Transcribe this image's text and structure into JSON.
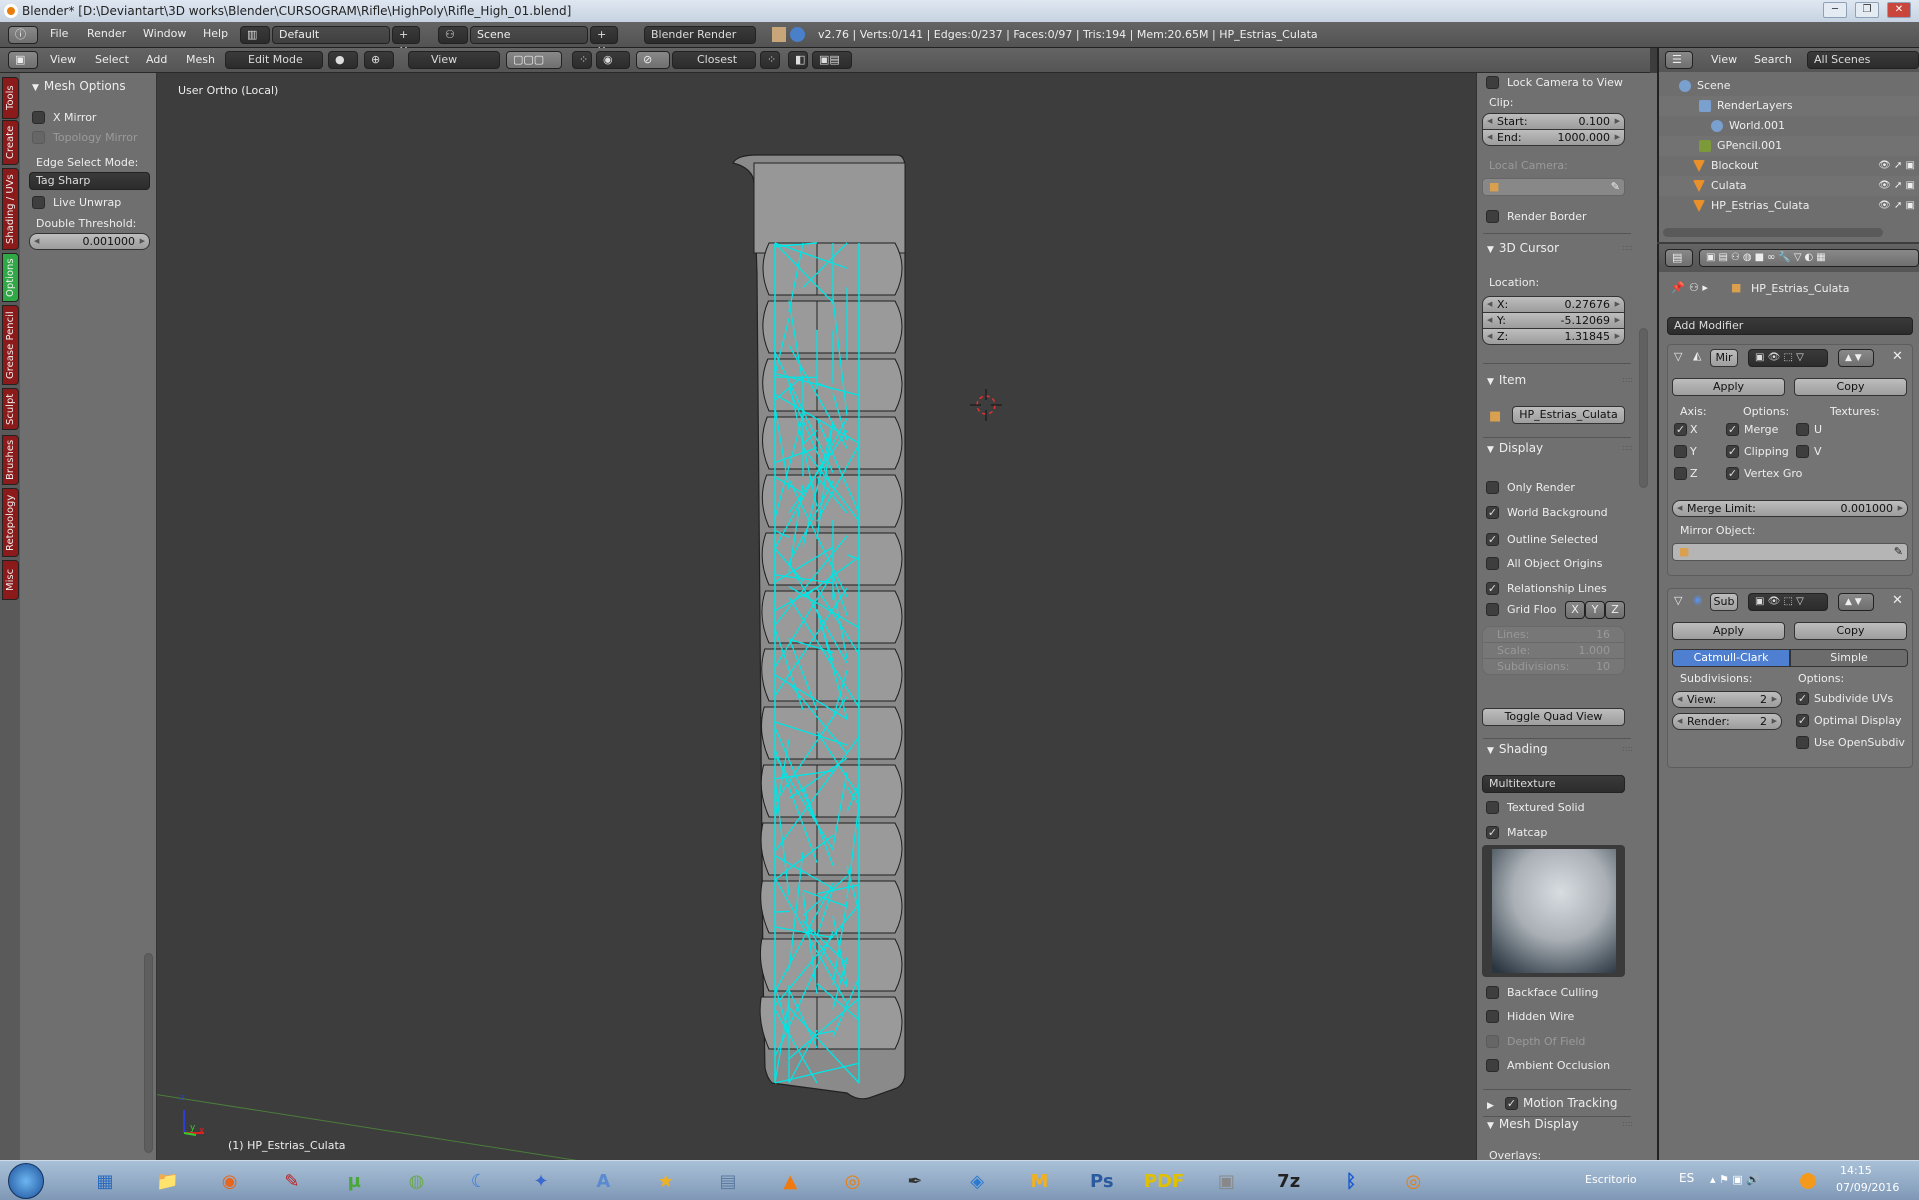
{
  "window": {
    "title": "Blender* [D:\\Deviantart\\3D works\\Blender\\CURSOGRAM\\Rifle\\HighPoly\\Rifle_High_01.blend]",
    "min": "─",
    "max": "❐",
    "close": "✕"
  },
  "info_header": {
    "menus": [
      "File",
      "Render",
      "Window",
      "Help"
    ],
    "layout": "Default",
    "scene": "Scene",
    "engine": "Blender Render",
    "stats": "v2.76 | Verts:0/141 | Edges:0/237 | Faces:0/97 | Tris:194 | Mem:20.65M | HP_Estrias_Culata"
  },
  "view3d_header": {
    "menus": [
      "View",
      "Select",
      "Add",
      "Mesh"
    ],
    "mode": "Edit Mode",
    "orientation": "View",
    "snap_target": "Closest"
  },
  "tool_tabs": [
    {
      "label": "Tools",
      "active": false
    },
    {
      "label": "Create",
      "active": false
    },
    {
      "label": "Shading / UVs",
      "active": false
    },
    {
      "label": "Options",
      "active": true
    },
    {
      "label": "Grease Pencil",
      "active": false
    },
    {
      "label": "Sculpt",
      "active": false
    },
    {
      "label": "Brushes",
      "active": false
    },
    {
      "label": "Retopology",
      "active": false
    },
    {
      "label": "Misc",
      "active": false
    }
  ],
  "tool_shelf": {
    "panel": "Mesh Options",
    "x_mirror": {
      "label": "X Mirror",
      "checked": false
    },
    "topology_mirror": {
      "label": "Topology Mirror",
      "checked": false
    },
    "edge_select_label": "Edge Select Mode:",
    "edge_select_value": "Tag Sharp",
    "live_unwrap": {
      "label": "Live Unwrap",
      "checked": false
    },
    "double_threshold_label": "Double Threshold:",
    "double_threshold": "0.001000"
  },
  "viewport": {
    "view_name": "User Ortho (Local)",
    "object_label": "(1) HP_Estrias_Culata",
    "axis_x": "x",
    "axis_y": "y",
    "axis_z": "z",
    "wire_color": "#00e5e5"
  },
  "n_panel": {
    "lock_camera": "Lock Camera to View",
    "clip_label": "Clip:",
    "clip_start_label": "Start:",
    "clip_start": "0.100",
    "clip_end_label": "End:",
    "clip_end": "1000.000",
    "local_camera_label": "Local Camera:",
    "render_border": {
      "label": "Render Border",
      "checked": false
    },
    "cursor_title": "3D Cursor",
    "location_label": "Location:",
    "x_label": "X:",
    "x": "0.27676",
    "y_label": "Y:",
    "y": "-5.12069",
    "z_label": "Z:",
    "z": "1.31845",
    "item_title": "Item",
    "item_name": "HP_Estrias_Culata",
    "display_title": "Display",
    "display_options": [
      {
        "label": "Only Render",
        "checked": false
      },
      {
        "label": "World Background",
        "checked": true
      },
      {
        "label": "Outline Selected",
        "checked": true
      },
      {
        "label": "All Object Origins",
        "checked": false
      },
      {
        "label": "Relationship Lines",
        "checked": true
      }
    ],
    "grid_floor": {
      "label": "Grid Floo",
      "checked": false
    },
    "grid_axes": [
      "X",
      "Y",
      "Z"
    ],
    "lines_label": "Lines:",
    "lines": "16",
    "scale_label": "Scale:",
    "scale": "1.000",
    "subdiv_label": "Subdivisions:",
    "subdiv": "10",
    "toggle_quad": "Toggle Quad View",
    "shading_title": "Shading",
    "shading_mode": "Multitexture",
    "textured_solid": {
      "label": "Textured Solid",
      "checked": false
    },
    "matcap": {
      "label": "Matcap",
      "checked": true
    },
    "shading_options": [
      {
        "label": "Backface Culling",
        "checked": false
      },
      {
        "label": "Hidden Wire",
        "checked": false
      },
      {
        "label": "Depth Of Field",
        "checked": false
      },
      {
        "label": "Ambient Occlusion",
        "checked": false
      }
    ],
    "motion_tracking": {
      "label": "Motion Tracking",
      "checked": true
    },
    "mesh_display_title": "Mesh Display",
    "overlays_label": "Overlays:"
  },
  "outliner": {
    "menus": [
      "View",
      "Search"
    ],
    "filter": "All Scenes",
    "items": [
      {
        "label": "Scene",
        "icon": "scene-icon"
      },
      {
        "label": "RenderLayers",
        "icon": "render-layers-icon"
      },
      {
        "label": "World.001",
        "icon": "world-icon"
      },
      {
        "label": "GPencil.001",
        "icon": "pencil-icon"
      },
      {
        "label": "Blockout",
        "icon": "mesh-icon"
      },
      {
        "label": "Culata",
        "icon": "mesh-icon"
      },
      {
        "label": "HP_Estrias_Culata",
        "icon": "mesh-icon"
      }
    ]
  },
  "properties": {
    "object": "HP_Estrias_Culata",
    "add_modifier": "Add Modifier",
    "mirror": {
      "name": "Mir",
      "apply": "Apply",
      "copy": "Copy",
      "axis_label": "Axis:",
      "options_label": "Options:",
      "textures_label": "Textures:",
      "axes": [
        {
          "label": "X",
          "checked": true
        },
        {
          "label": "Y",
          "checked": false
        },
        {
          "label": "Z",
          "checked": false
        }
      ],
      "options": [
        {
          "label": "Merge",
          "checked": true
        },
        {
          "label": "Clipping",
          "checked": true
        },
        {
          "label": "Vertex Gro",
          "checked": true
        }
      ],
      "textures": [
        {
          "label": "U",
          "checked": false
        },
        {
          "label": "V",
          "checked": false
        }
      ],
      "merge_limit_label": "Merge Limit:",
      "merge_limit": "0.001000",
      "mirror_object_label": "Mirror Object:"
    },
    "subsurf": {
      "name": "Sub",
      "apply": "Apply",
      "copy": "Copy",
      "catmull": "Catmull-Clark",
      "simple": "Simple",
      "subdivisions_label": "Subdivisions:",
      "options_label": "Options:",
      "view_label": "View:",
      "view": "2",
      "render_label": "Render:",
      "render": "2",
      "options": [
        {
          "label": "Subdivide UVs",
          "checked": true
        },
        {
          "label": "Optimal Display",
          "checked": true
        },
        {
          "label": "Use OpenSubdiv",
          "checked": false
        }
      ]
    }
  },
  "taskbar": {
    "apps": [
      "control-panel",
      "file-explorer",
      "firefox",
      "mouse-app",
      "utorrent",
      "android-app",
      "browser-app",
      "paint-app",
      "text-app",
      "120x-app",
      "calculator",
      "vlc",
      "blender",
      "inkscape",
      "shield-app",
      "maya",
      "photoshop",
      "pdf-reader",
      "camera-app",
      "7zip",
      "bluetooth",
      "blender"
    ],
    "app_glyphs": [
      "▦",
      "📁",
      "◉",
      "✎",
      "µ",
      "◍",
      "☾",
      "✦",
      "A",
      "★",
      "▤",
      "▲",
      "◎",
      "✒",
      "◈",
      "M",
      "Ps",
      "PDF",
      "▣",
      "7z",
      "ᛒ",
      "◎"
    ],
    "desktop_label": "Escritorio",
    "language": "ES",
    "time": "14:15",
    "date": "07/09/2016"
  },
  "colors": {
    "accent_tab": "#2fa845",
    "tab": "#8b1a1a",
    "catmull_selected": "#4f7fd0",
    "wire": "#00e5e5"
  }
}
